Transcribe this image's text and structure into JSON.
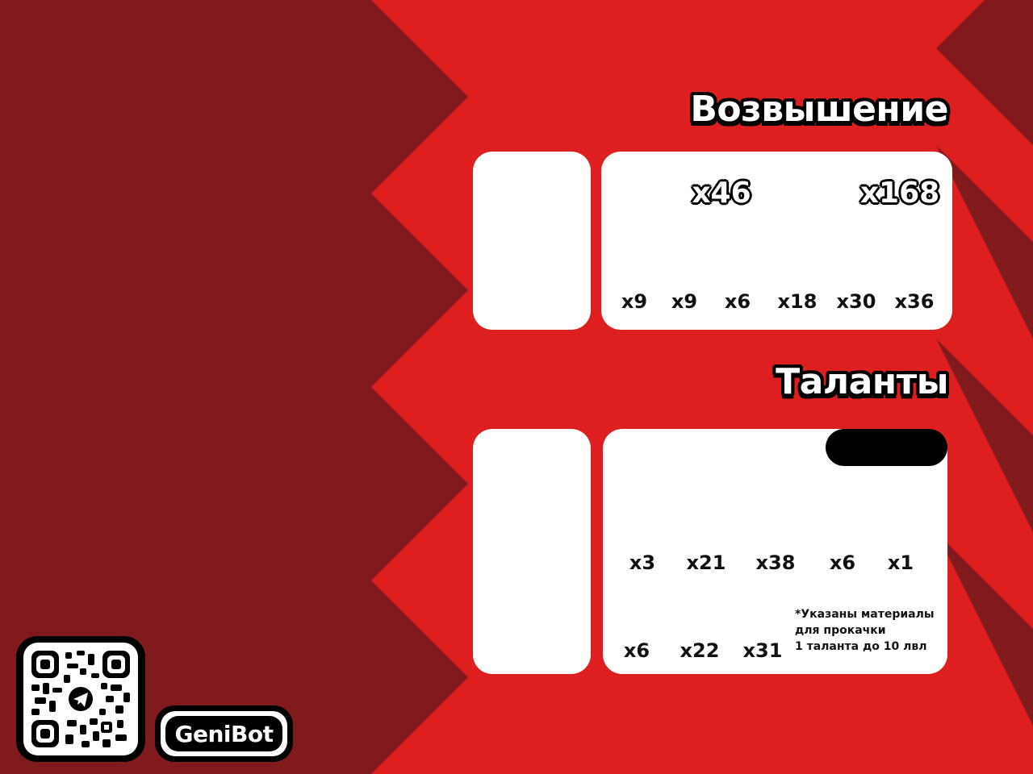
{
  "colors": {
    "dark_red": "#801a1c",
    "bright_red": "#de1f1f",
    "card_white": "#ffffff",
    "outline_black": "#000000"
  },
  "ascension": {
    "title": "Возвышение",
    "top_quantities": [
      "x46",
      "x168"
    ],
    "bottom_quantities": [
      "x9",
      "x9",
      "x6",
      "x18",
      "x30",
      "x36"
    ]
  },
  "talents": {
    "title": "Таланты",
    "row1_quantities": [
      "x3",
      "x21",
      "x38",
      "x6",
      "x1"
    ],
    "row2_quantities": [
      "x6",
      "x22",
      "x31"
    ],
    "note": "*Указаны материалы\nдля прокачки\n1 таланта до 10 лвл"
  },
  "brand": {
    "name": "GeniBot",
    "qr_icon": "telegram-qr-code-icon"
  }
}
